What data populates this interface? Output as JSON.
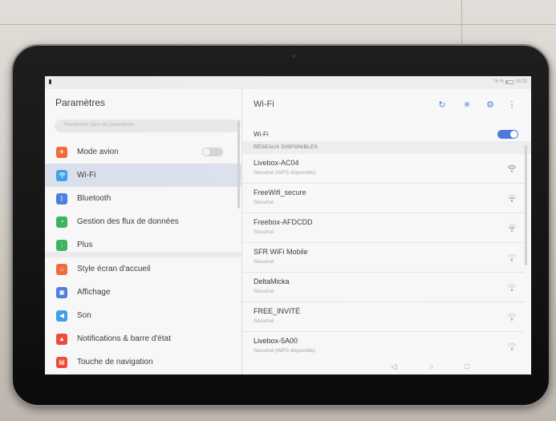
{
  "status": {
    "battery_text": "76 %",
    "time": "08:25"
  },
  "settings": {
    "title": "Paramètres",
    "search_placeholder": "Rechercher dans les paramètres",
    "items": [
      {
        "label": "Mode avion",
        "icon": "airplane-icon",
        "color": "#ef6b3a"
      },
      {
        "label": "Wi-Fi",
        "icon": "wifi-icon",
        "color": "#3ea0e6"
      },
      {
        "label": "Bluetooth",
        "icon": "bluetooth-icon",
        "color": "#4d7fe0"
      },
      {
        "label": "Gestion des flux de données",
        "icon": "data-usage-icon",
        "color": "#3cb460"
      },
      {
        "label": "Plus",
        "icon": "more-icon",
        "color": "#3cb460"
      },
      {
        "label": "Style écran d'accueil",
        "icon": "home-style-icon",
        "color": "#ef6b3a"
      },
      {
        "label": "Affichage",
        "icon": "display-icon",
        "color": "#4d7fe0"
      },
      {
        "label": "Son",
        "icon": "sound-icon",
        "color": "#3ea0e6"
      },
      {
        "label": "Notifications & barre d'état",
        "icon": "notifications-icon",
        "color": "#ef4a3a"
      },
      {
        "label": "Touche de navigation",
        "icon": "navigation-key-icon",
        "color": "#ef4a3a"
      }
    ],
    "airplane_mode_on": false,
    "active_item": "Wi-Fi"
  },
  "wifi": {
    "title": "Wi-Fi",
    "toggle_label": "Wi-Fi",
    "enabled": true,
    "section_header": "RÉSEAUX DISPONIBLES",
    "networks": [
      {
        "name": "Livebox-AC04",
        "security": "Sécurisé (WPS disponible)"
      },
      {
        "name": "FreeWifi_secure",
        "security": "Sécurisé"
      },
      {
        "name": "Freebox-AFDCDD",
        "security": "Sécurisé"
      },
      {
        "name": "SFR WiFi Mobile",
        "security": "Sécurisé"
      },
      {
        "name": "DeltaMicka",
        "security": "Sécurisé"
      },
      {
        "name": "FREE_INVITÉ",
        "security": "Sécurisé"
      },
      {
        "name": "Livebox-5A00",
        "security": "Sécurisé (WPS disponible)"
      }
    ],
    "accent": "#3d6fd8"
  }
}
